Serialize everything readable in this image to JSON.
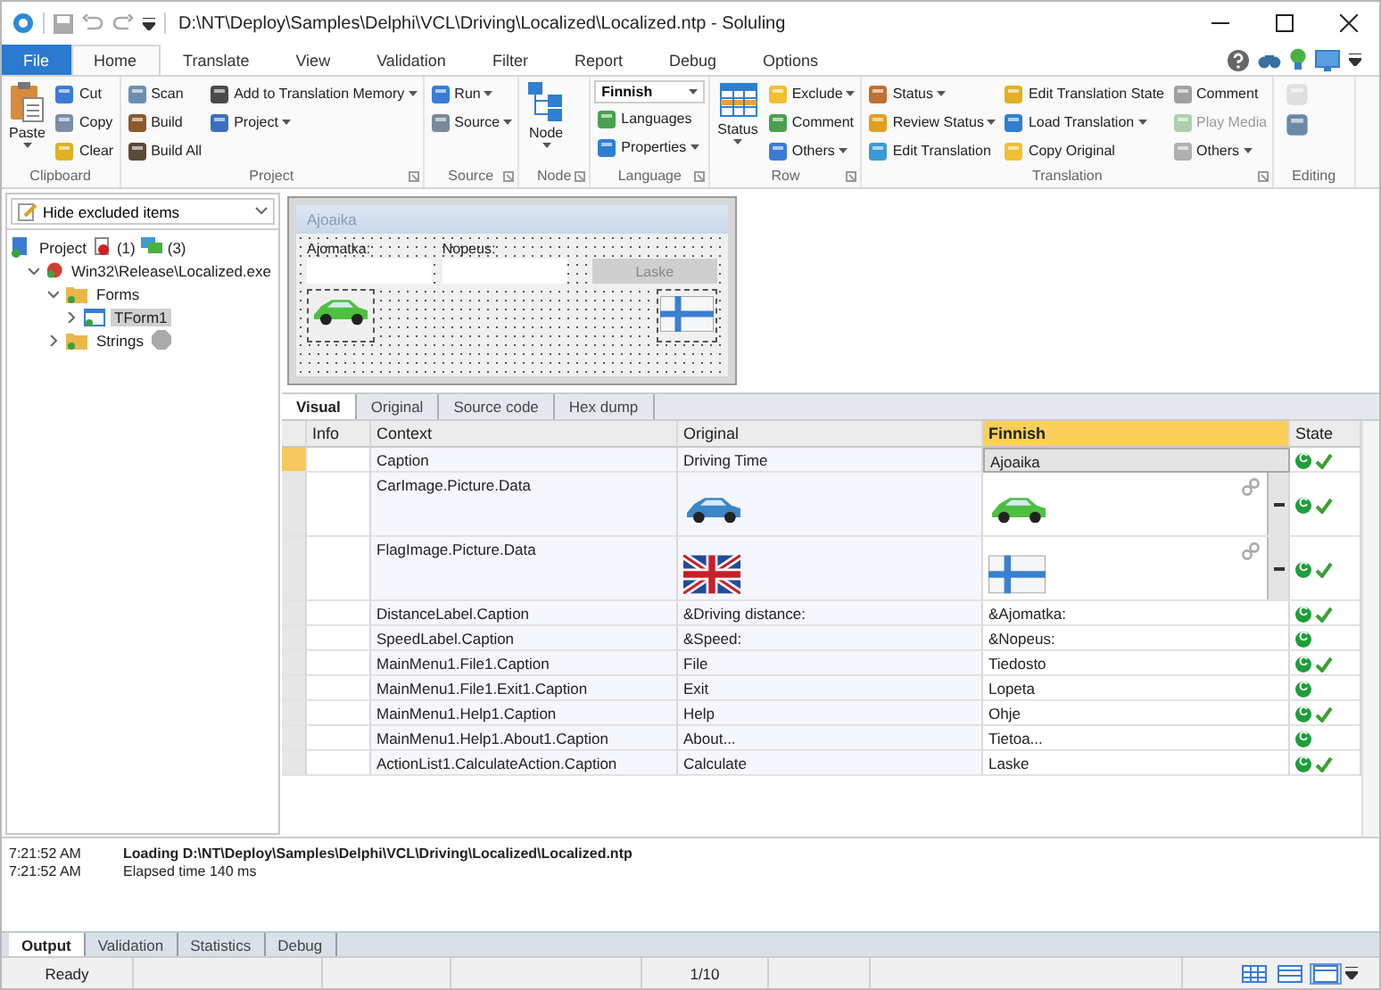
{
  "window": {
    "title": "D:\\NT\\Deploy\\Samples\\Delphi\\VCL\\Driving\\Localized\\Localized.ntp  -  Soluling"
  },
  "ribbon_tabs": [
    {
      "label": "File",
      "kind": "file",
      "selected": false
    },
    {
      "label": "Home",
      "kind": "tab",
      "selected": true
    },
    {
      "label": "Translate",
      "kind": "tab",
      "selected": false
    },
    {
      "label": "View",
      "kind": "tab",
      "selected": false
    },
    {
      "label": "Validation",
      "kind": "tab",
      "selected": false
    },
    {
      "label": "Filter",
      "kind": "tab",
      "selected": false
    },
    {
      "label": "Report",
      "kind": "tab",
      "selected": false
    },
    {
      "label": "Debug",
      "kind": "tab",
      "selected": false
    },
    {
      "label": "Options",
      "kind": "tab",
      "selected": false
    }
  ],
  "ribbon_groups": [
    {
      "label": "Clipboard",
      "launcher": false,
      "columns": [
        [
          {
            "label": "Paste",
            "kind": "large",
            "dropdown": true,
            "disabled": false
          }
        ],
        [
          {
            "label": "Cut",
            "kind": "small",
            "dropdown": false,
            "disabled": false
          },
          {
            "label": "Copy",
            "kind": "small",
            "dropdown": false,
            "disabled": false
          },
          {
            "label": "Clear",
            "kind": "small",
            "dropdown": false,
            "disabled": false
          }
        ]
      ]
    },
    {
      "label": "Project",
      "launcher": true,
      "columns": [
        [
          {
            "label": "Scan",
            "kind": "small",
            "dropdown": false,
            "disabled": false
          },
          {
            "label": "Build",
            "kind": "small",
            "dropdown": false,
            "disabled": false
          },
          {
            "label": "Build All",
            "kind": "small",
            "dropdown": false,
            "disabled": false
          }
        ],
        [
          {
            "label": "Add to Translation Memory",
            "kind": "small",
            "dropdown": true,
            "disabled": false
          },
          {
            "label": "Project",
            "kind": "small",
            "dropdown": true,
            "disabled": false
          }
        ]
      ]
    },
    {
      "label": "Source",
      "launcher": true,
      "columns": [
        [
          {
            "label": "Run",
            "kind": "small",
            "dropdown": true,
            "disabled": false
          },
          {
            "label": "Source",
            "kind": "small",
            "dropdown": true,
            "disabled": false
          }
        ]
      ]
    },
    {
      "label": "Node",
      "launcher": true,
      "columns": [
        [
          {
            "label": "Node",
            "kind": "large",
            "dropdown": true,
            "disabled": false
          }
        ]
      ]
    },
    {
      "label": "Language",
      "launcher": true,
      "columns": [
        [
          {
            "label": "Finnish",
            "kind": "combo",
            "dropdown": true,
            "disabled": false
          },
          {
            "label": "Languages",
            "kind": "small",
            "dropdown": false,
            "disabled": false
          },
          {
            "label": "Properties",
            "kind": "small",
            "dropdown": true,
            "disabled": false
          }
        ]
      ]
    },
    {
      "label": "Row",
      "launcher": true,
      "columns": [
        [
          {
            "label": "Status",
            "kind": "large",
            "dropdown": true,
            "disabled": false
          }
        ],
        [
          {
            "label": "Exclude",
            "kind": "small",
            "dropdown": true,
            "disabled": false
          },
          {
            "label": "Comment",
            "kind": "small",
            "dropdown": false,
            "disabled": false
          },
          {
            "label": "Others",
            "kind": "small",
            "dropdown": true,
            "disabled": false
          }
        ]
      ]
    },
    {
      "label": "Translation",
      "launcher": true,
      "columns": [
        [
          {
            "label": "Status",
            "kind": "small",
            "dropdown": true,
            "disabled": false
          },
          {
            "label": "Review Status",
            "kind": "small",
            "dropdown": true,
            "disabled": false
          },
          {
            "label": "Edit Translation",
            "kind": "small",
            "dropdown": false,
            "disabled": false
          }
        ],
        [
          {
            "label": "Edit Translation State",
            "kind": "small",
            "dropdown": false,
            "disabled": false
          },
          {
            "label": "Load Translation",
            "kind": "small",
            "dropdown": true,
            "disabled": false
          },
          {
            "label": "Copy Original",
            "kind": "small",
            "dropdown": false,
            "disabled": false
          }
        ],
        [
          {
            "label": "Comment",
            "kind": "small",
            "dropdown": false,
            "disabled": false
          },
          {
            "label": "Play Media",
            "kind": "small",
            "dropdown": false,
            "disabled": true
          },
          {
            "label": "Others",
            "kind": "small",
            "dropdown": true,
            "disabled": false
          }
        ]
      ]
    },
    {
      "label": "Editing",
      "launcher": false,
      "columns": [
        [
          {
            "kind": "icon",
            "disabled": true
          },
          {
            "kind": "icon",
            "disabled": false
          }
        ]
      ]
    }
  ],
  "filter": {
    "value": "Hide excluded items"
  },
  "tree": [
    {
      "label": "Project",
      "kind": "project",
      "selected": false,
      "excluded": false,
      "counts": [
        "(1)",
        "(3)"
      ],
      "children": [
        {
          "label": "Win32\\Release\\Localized.exe",
          "kind": "executable",
          "expanded": true,
          "selected": false,
          "excluded": false,
          "children": [
            {
              "label": "Forms",
              "kind": "folder",
              "expanded": true,
              "selected": false,
              "excluded": false,
              "children": [
                {
                  "label": "TForm1",
                  "kind": "form",
                  "expanded": false,
                  "selected": true,
                  "excluded": false
                }
              ]
            },
            {
              "label": "Strings",
              "kind": "folder",
              "expanded": false,
              "selected": false,
              "excluded": true
            }
          ]
        }
      ]
    }
  ],
  "preview": {
    "title": "Ajoaika",
    "labels": [
      "Ajomatka:",
      "Nopeus:"
    ],
    "button": "Laske"
  },
  "editor_tabs": [
    {
      "label": "Visual",
      "selected": true
    },
    {
      "label": "Original",
      "selected": false
    },
    {
      "label": "Source code",
      "selected": false
    },
    {
      "label": "Hex dump",
      "selected": false
    }
  ],
  "table": {
    "columns": [
      {
        "label": "Info",
        "selected": false
      },
      {
        "label": "Context",
        "selected": false
      },
      {
        "label": "Original",
        "selected": false
      },
      {
        "label": "Finnish",
        "selected": true
      },
      {
        "label": "State",
        "selected": false
      }
    ],
    "rows": [
      {
        "kind": "text",
        "context": "Caption",
        "original": "Driving Time",
        "translation": "Ajoaika",
        "state": "C",
        "checked": true,
        "selected": true
      },
      {
        "kind": "car",
        "context": "CarImage.Picture.Data",
        "state": "C",
        "checked": true,
        "selected": false
      },
      {
        "kind": "flag",
        "context": "FlagImage.Picture.Data",
        "state": "C",
        "checked": true,
        "selected": false
      },
      {
        "kind": "text",
        "context": "DistanceLabel.Caption",
        "original": "&Driving distance:",
        "translation": "&Ajomatka:",
        "state": "C",
        "checked": true,
        "selected": false
      },
      {
        "kind": "text",
        "context": "SpeedLabel.Caption",
        "original": "&Speed:",
        "translation": "&Nopeus:",
        "state": "C",
        "checked": false,
        "selected": false
      },
      {
        "kind": "text",
        "context": "MainMenu1.File1.Caption",
        "original": "File",
        "translation": "Tiedosto",
        "state": "C",
        "checked": true,
        "selected": false
      },
      {
        "kind": "text",
        "context": "MainMenu1.File1.Exit1.Caption",
        "original": "Exit",
        "translation": "Lopeta",
        "state": "C",
        "checked": false,
        "selected": false
      },
      {
        "kind": "text",
        "context": "MainMenu1.Help1.Caption",
        "original": "Help",
        "translation": "Ohje",
        "state": "C",
        "checked": true,
        "selected": false
      },
      {
        "kind": "text",
        "context": "MainMenu1.Help1.About1.Caption",
        "original": "About...",
        "translation": "Tietoa...",
        "state": "C",
        "checked": false,
        "selected": false
      },
      {
        "kind": "text",
        "context": "ActionList1.CalculateAction.Caption",
        "original": "Calculate",
        "translation": "Laske",
        "state": "C",
        "checked": true,
        "selected": false
      }
    ]
  },
  "output": {
    "lines": [
      {
        "time": "7:21:52 AM",
        "message": "Loading D:\\NT\\Deploy\\Samples\\Delphi\\VCL\\Driving\\Localized\\Localized.ntp",
        "bold": true
      },
      {
        "time": "7:21:52 AM",
        "message": "Elapsed time 140 ms",
        "bold": false
      }
    ],
    "tabs": [
      {
        "label": "Output",
        "selected": true
      },
      {
        "label": "Validation",
        "selected": false
      },
      {
        "label": "Statistics",
        "selected": false
      },
      {
        "label": "Debug",
        "selected": false
      }
    ]
  },
  "status_bar": {
    "status": "Ready",
    "position": "1/10",
    "view_modes": [
      {
        "selected": false
      },
      {
        "selected": false
      },
      {
        "selected": true
      }
    ]
  }
}
